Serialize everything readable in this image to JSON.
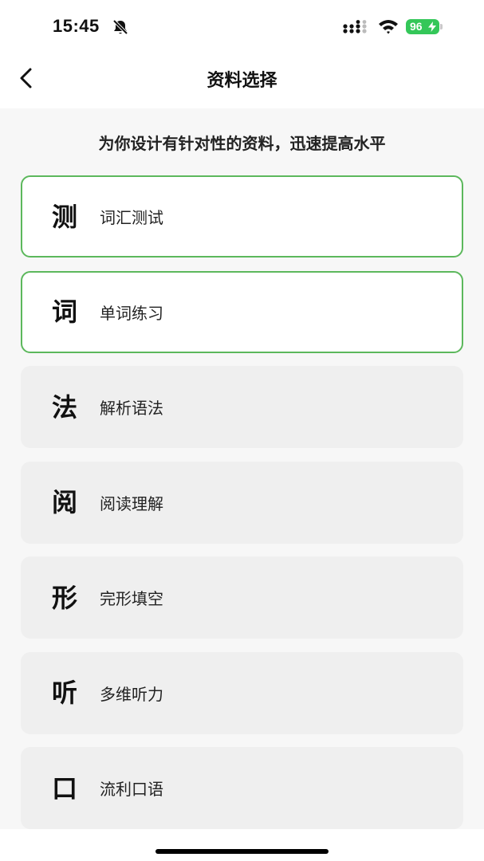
{
  "status_bar": {
    "time": "15:45",
    "battery_level": "96",
    "icons": [
      "bell-muted-icon",
      "cellular-signal-icon",
      "wifi-icon",
      "battery-charging-icon"
    ]
  },
  "nav": {
    "back_icon": "chevron-left-icon",
    "title": "资料选择"
  },
  "subtitle": "为你设计有针对性的资料，迅速提高水平",
  "colors": {
    "accent": "#5cb85c",
    "card_bg": "#efefef",
    "selected_bg": "#ffffff",
    "battery": "#34c759"
  },
  "items": [
    {
      "icon": "测",
      "label": "词汇测试",
      "selected": true
    },
    {
      "icon": "词",
      "label": "单词练习",
      "selected": true
    },
    {
      "icon": "法",
      "label": "解析语法",
      "selected": false
    },
    {
      "icon": "阅",
      "label": "阅读理解",
      "selected": false
    },
    {
      "icon": "形",
      "label": "完形填空",
      "selected": false
    },
    {
      "icon": "听",
      "label": "多维听力",
      "selected": false
    },
    {
      "icon": "口",
      "label": "流利口语",
      "selected": false
    }
  ]
}
